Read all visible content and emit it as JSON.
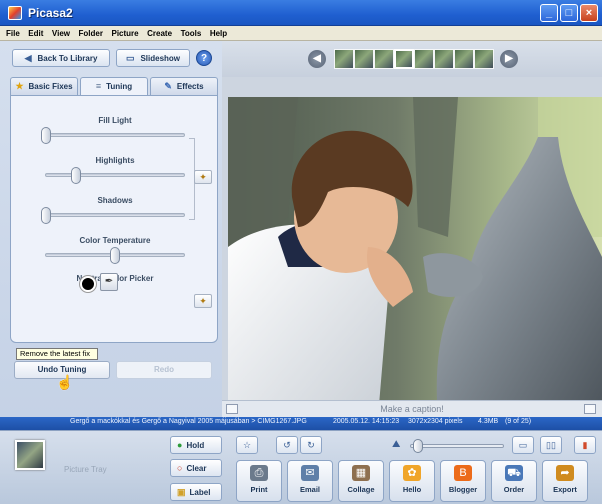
{
  "window": {
    "title": "Picasa2"
  },
  "menu": [
    "File",
    "Edit",
    "View",
    "Folder",
    "Picture",
    "Create",
    "Tools",
    "Help"
  ],
  "toolbar": {
    "back_label": "Back To Library",
    "slideshow_label": "Slideshow",
    "help_label": "?"
  },
  "tabs": [
    {
      "label": "Basic Fixes",
      "icon": "star-icon"
    },
    {
      "label": "Tuning",
      "icon": "sliders-icon",
      "active": true
    },
    {
      "label": "Effects",
      "icon": "brush-icon"
    }
  ],
  "tuning": {
    "sliders": [
      {
        "label": "Fill Light",
        "value": 0.0
      },
      {
        "label": "Highlights",
        "value": 0.22
      },
      {
        "label": "Shadows",
        "value": 0.0
      },
      {
        "label": "Color Temperature",
        "value": 0.5
      }
    ],
    "neutral_color_label": "Neutral Color Picker",
    "tooltip": "Remove the latest fix",
    "undo_label": "Undo Tuning",
    "redo_label": "Redo"
  },
  "filmstrip": {
    "thumbnail_count": 8,
    "selected_index": 3
  },
  "caption": {
    "placeholder": "Make a caption!"
  },
  "status": {
    "album": "Gergő a mackókkal és Gergő a Nagyival 2005 májusában > CIMG1267.JPG",
    "datetime": "2005.05.12. 14:15:23",
    "dimensions": "3072x2304 pixels",
    "size": "4.3MB",
    "position": "(9 of 25)"
  },
  "tray": {
    "label": "Picture Tray",
    "hold_label": "Hold",
    "clear_label": "Clear",
    "label_label": "Label"
  },
  "actions": [
    "Print",
    "Email",
    "Collage",
    "Hello",
    "Blogger",
    "Order",
    "Export"
  ],
  "colors": {
    "titlebar": "#1f5fd0",
    "statusbar": "#2456b3",
    "accent": "#3a5f96"
  }
}
